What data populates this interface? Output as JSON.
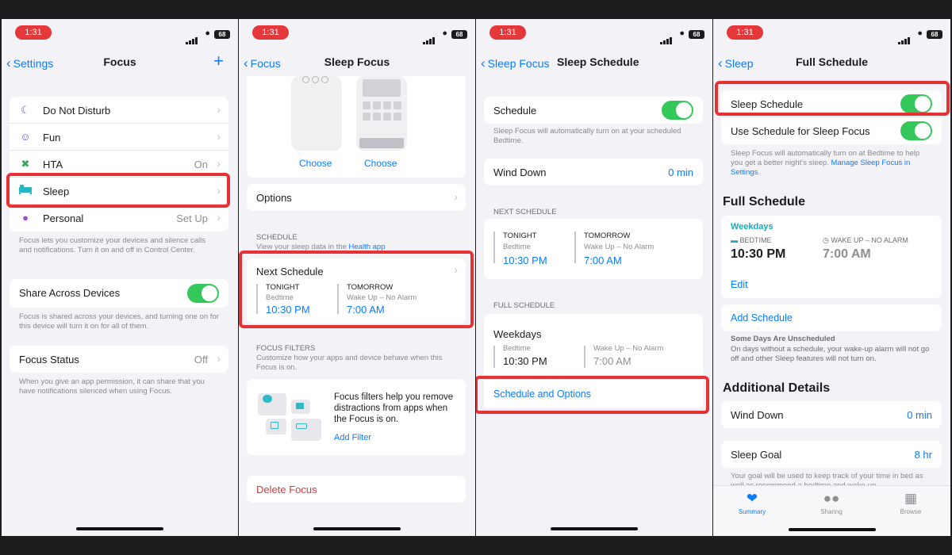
{
  "status_time": "1:31",
  "battery": "68",
  "icons": {
    "back": "chevron-left-icon",
    "forward": "chevron-right-icon",
    "add": "plus-icon"
  },
  "colors": {
    "accent": "#0a7cff",
    "toggle_on": "#34c759",
    "highlight": "#e63234",
    "destructive": "#d93a3a"
  },
  "p1": {
    "back": "Settings",
    "title": "Focus",
    "items": [
      {
        "label": "Do Not Disturb",
        "value": "",
        "icon": "moon-icon"
      },
      {
        "label": "Fun",
        "value": "",
        "icon": "smiley-icon"
      },
      {
        "label": "HTA",
        "value": "On",
        "icon": "tools-icon"
      },
      {
        "label": "Sleep",
        "value": "",
        "icon": "bed-icon"
      },
      {
        "label": "Personal",
        "value": "Set Up",
        "icon": "person-icon"
      }
    ],
    "focus_note": "Focus lets you customize your devices and silence calls and notifications. Turn it on and off in Control Center.",
    "share_label": "Share Across Devices",
    "share_note": "Focus is shared across your devices, and turning one on for this device will turn it on for all of them.",
    "status_label": "Focus Status",
    "status_value": "Off",
    "status_note": "When you give an app permission, it can share that you have notifications silenced when using Focus."
  },
  "p2": {
    "back": "Focus",
    "title": "Sleep Focus",
    "choose1": "Choose",
    "choose2": "Choose",
    "options": "Options",
    "schedule_header": "SCHEDULE",
    "schedule_note_pre": "View your sleep data in the ",
    "schedule_note_link": "Health app",
    "next_schedule": "Next Schedule",
    "tonight": "TONIGHT",
    "bedtime": "Bedtime",
    "bed_time": "10:30 PM",
    "tomorrow": "TOMORROW",
    "wake": "Wake Up – No Alarm",
    "wake_time": "7:00 AM",
    "filters_header": "FOCUS FILTERS",
    "filters_note": "Customize how your apps and device behave when this Focus is on.",
    "filters_text": "Focus filters help you remove distractions from apps when the Focus is on.",
    "add_filter": "Add Filter",
    "delete": "Delete Focus"
  },
  "p3": {
    "back": "Sleep Focus",
    "title": "Sleep Schedule",
    "schedule_label": "Schedule",
    "schedule_note": "Sleep Focus will automatically turn on at your scheduled Bedtime.",
    "wind_down": "Wind Down",
    "wind_value": "0 min",
    "next_header": "NEXT SCHEDULE",
    "tonight": "TONIGHT",
    "bedtime": "Bedtime",
    "bed_time": "10:30 PM",
    "tomorrow": "TOMORROW",
    "wake": "Wake Up – No Alarm",
    "wake_time": "7:00 AM",
    "full_header": "FULL SCHEDULE",
    "weekdays": "Weekdays",
    "bedtime2": "Bedtime",
    "bed_time2": "10:30 PM",
    "wake2": "Wake Up – No Alarm",
    "wake_time2": "7:00 AM",
    "sched_options": "Schedule and Options"
  },
  "p4": {
    "back": "Sleep",
    "title": "Full Schedule",
    "sleep_schedule": "Sleep Schedule",
    "use_schedule": "Use Schedule for Sleep Focus",
    "note_pre": "Sleep Focus will automatically turn on at Bedtime to help you get a better night's sleep. ",
    "note_link": "Manage Sleep Focus in Settings.",
    "full_title": "Full Schedule",
    "weekdays": "Weekdays",
    "bedtime_cap": "BEDTIME",
    "bed_time": "10:30 PM",
    "wake_cap": "WAKE UP – NO ALARM",
    "wake_time": "7:00 AM",
    "edit": "Edit",
    "add_schedule": "Add Schedule",
    "unsched_title": "Some Days Are Unscheduled",
    "unsched_note": "On days without a schedule, your wake-up alarm will not go off and other Sleep features will not turn on.",
    "additional": "Additional Details",
    "wind_down": "Wind Down",
    "wind_value": "0 min",
    "sleep_goal": "Sleep Goal",
    "goal_value": "8 hr",
    "goal_note": "Your goal will be used to keep track of your time in bed as well as recommend a bedtime and wake-up",
    "tabs": [
      "Summary",
      "Sharing",
      "Browse"
    ]
  }
}
